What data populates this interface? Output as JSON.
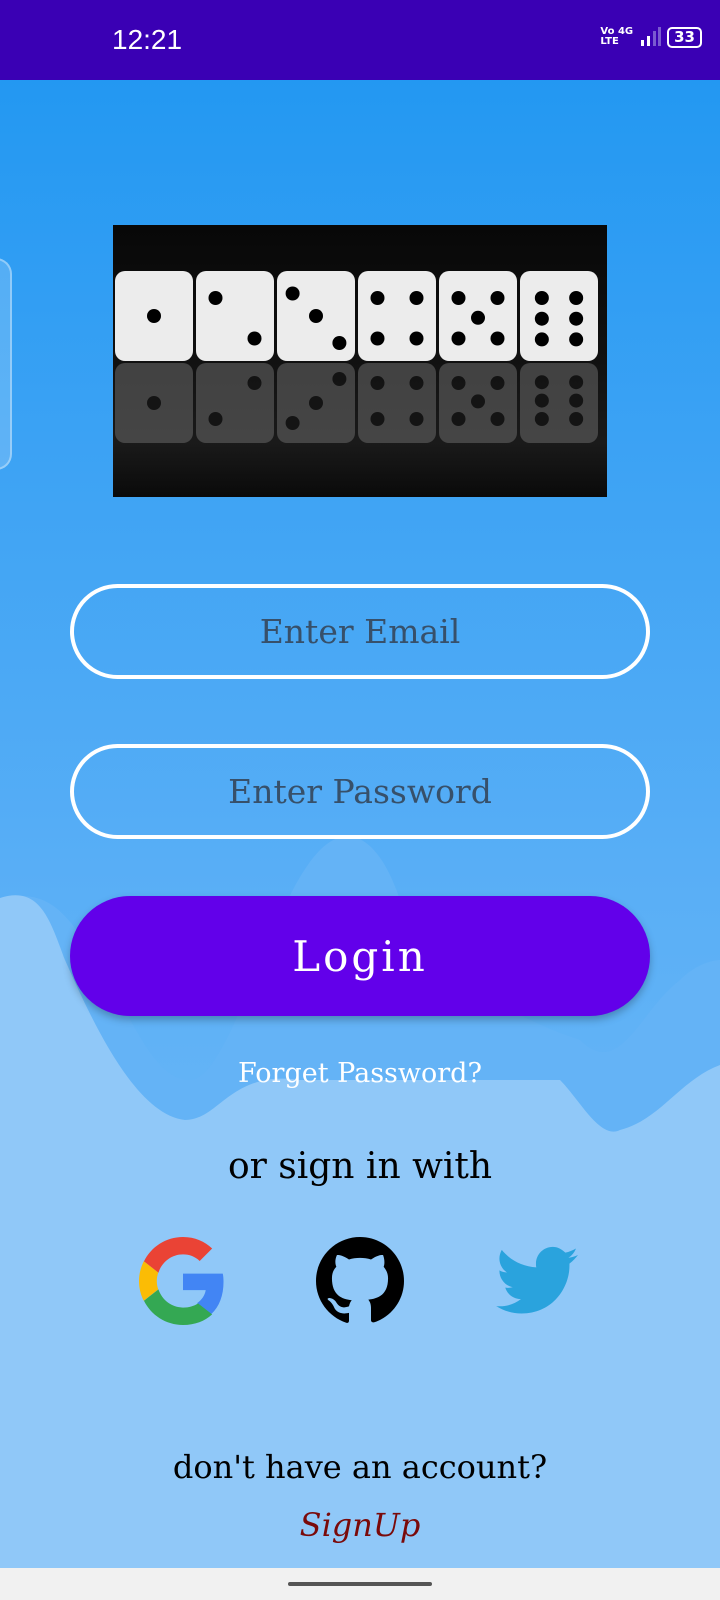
{
  "status_bar": {
    "time": "12:21",
    "network_top": "Vo 4G",
    "network_bottom": "LTE",
    "battery": "33"
  },
  "form": {
    "email_placeholder": "Enter Email",
    "password_placeholder": "Enter Password",
    "login_label": "Login",
    "forgot_label": "Forget Password?"
  },
  "social": {
    "heading": "or sign in with",
    "providers": [
      "google-icon",
      "github-icon",
      "twitter-icon"
    ]
  },
  "signup": {
    "prompt": "don't have an account?",
    "link": "SignUp"
  },
  "colors": {
    "status_bar": "#3a00b4",
    "login_button": "#6200ea",
    "signup_link": "#7a0a0a"
  }
}
